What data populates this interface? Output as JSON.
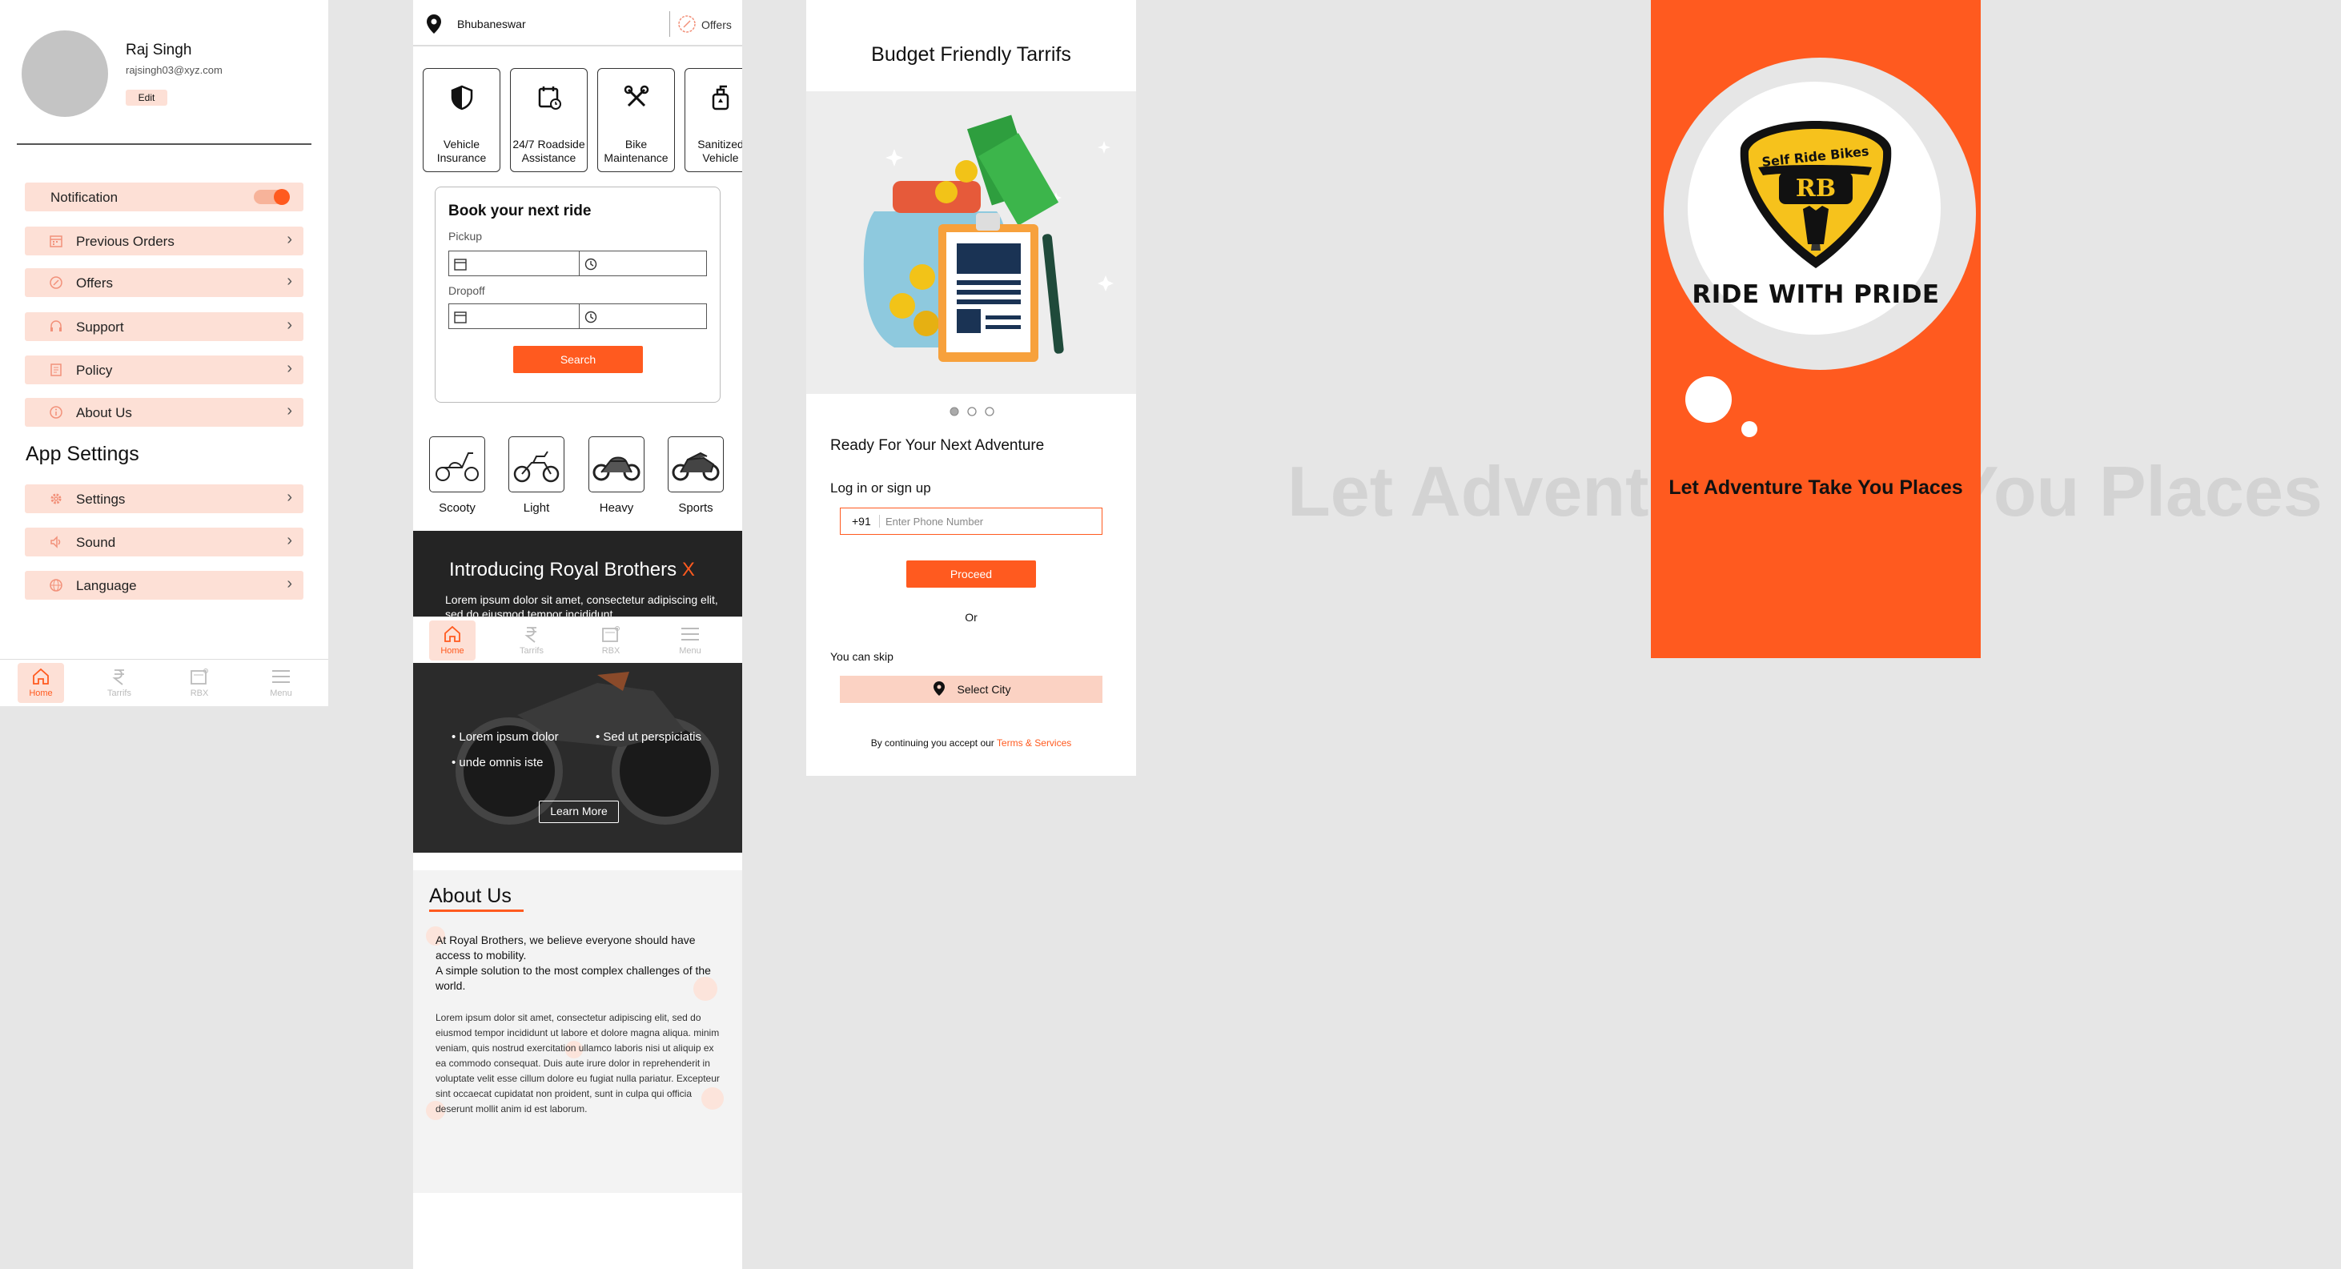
{
  "profile": {
    "name": "Raj Singh",
    "email": "rajsingh03@xyz.com",
    "edit_label": "Edit",
    "menu": [
      {
        "label": "Notification",
        "icon": "toggle-icon"
      },
      {
        "label": "Previous Orders",
        "icon": "calendar-icon"
      },
      {
        "label": "Offers",
        "icon": "offers-icon"
      },
      {
        "label": "Support",
        "icon": "headset-icon"
      },
      {
        "label": "Policy",
        "icon": "document-icon"
      },
      {
        "label": "About Us",
        "icon": "info-icon"
      }
    ],
    "app_settings_title": "App Settings",
    "settings_menu": [
      {
        "label": "Settings",
        "icon": "gear-icon"
      },
      {
        "label": "Sound",
        "icon": "speaker-icon"
      },
      {
        "label": "Language",
        "icon": "globe-icon"
      }
    ]
  },
  "bottom_nav": [
    {
      "label": "Home",
      "icon": "home-icon"
    },
    {
      "label": "Tarrifs",
      "icon": "rupee-icon"
    },
    {
      "label": "RBX",
      "icon": "rbx-icon"
    },
    {
      "label": "Menu",
      "icon": "menu-icon"
    }
  ],
  "home": {
    "city": "Bhubaneswar",
    "offers_label": "Offers",
    "services": [
      {
        "label": "Vehicle Insurance",
        "icon": "shield-icon"
      },
      {
        "label": "24/7 Roadside Assistance",
        "icon": "calendar-clock-icon"
      },
      {
        "label": "Bike Maintenance",
        "icon": "tools-icon"
      },
      {
        "label": "Sanitized Vehicle",
        "icon": "sanitizer-icon"
      }
    ],
    "book_title": "Book your next ride",
    "pickup_label": "Pickup",
    "dropoff_label": "Dropoff",
    "search_label": "Search",
    "bike_types": [
      "Scooty",
      "Light",
      "Heavy",
      "Sports"
    ],
    "promo": {
      "title": "Introducing Royal Brothers ",
      "title_accent": "X",
      "body": "Lorem ipsum dolor sit amet, consectetur adipiscing elit, sed do eiusmod tempor incididunt",
      "bullet1": "Lorem ipsum dolor",
      "bullet2": "Sed ut perspiciatis",
      "bullet3": "unde omnis iste",
      "button": "Learn More"
    },
    "about_title": "About Us",
    "about_intro": "At Royal Brothers, we believe everyone should have access to mobility.\nA simple solution to the most complex challenges of the world.",
    "about_body": "Lorem ipsum dolor sit amet, consectetur adipiscing elit, sed do eiusmod tempor incididunt ut labore et dolore magna aliqua. minim veniam, quis nostrud exercitation ullamco laboris nisi ut aliquip ex ea commodo consequat. Duis aute irure dolor in reprehenderit in voluptate velit esse cillum dolore eu fugiat nulla pariatur. Excepteur sint occaecat cupidatat non proident, sunt in culpa qui officia deserunt mollit anim id est laborum."
  },
  "login": {
    "title": "Budget Friendly Tarrifs",
    "headline": "Ready For Your Next Adventure",
    "login_label": "Log in or sign up",
    "country_code": "+91",
    "phone_placeholder": "Enter Phone Number",
    "proceed_label": "Proceed",
    "or_label": "Or",
    "skip_label": "You can skip",
    "select_city_label": "Select City",
    "terms_prefix": "By continuing you accept our ",
    "terms_link": "Terms & Services"
  },
  "splash": {
    "brand_top": "Self Ride Bikes",
    "brand_mark": "RB",
    "slogan": "RIDE WITH PRIDE",
    "tagline": "Let Adventure Take You Places"
  },
  "background_text": "Let Adventure Take You Places",
  "colors": {
    "accent": "#ff5a1f",
    "accent_light": "#fde0d6",
    "canvas": "#e6e6e6"
  }
}
